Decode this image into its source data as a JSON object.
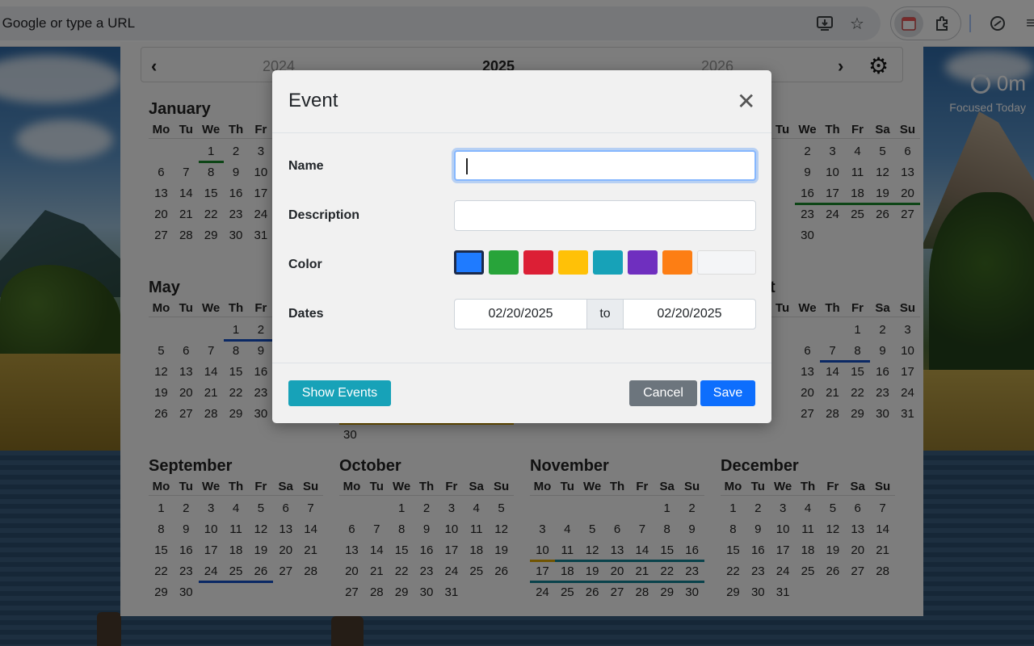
{
  "browser": {
    "omnibox_text": "ch Google or type a URL"
  },
  "focus_widget": {
    "value": "0m",
    "label": "Focused Today"
  },
  "calendar": {
    "prev_year": "2024",
    "current_year": "2025",
    "next_year": "2026",
    "weekday_headers": [
      "Mo",
      "Tu",
      "We",
      "Th",
      "Fr",
      "Sa",
      "Su"
    ],
    "months": {
      "january": {
        "title": "January",
        "weeks": [
          [
            "",
            "",
            "1",
            "2",
            "3",
            "",
            ""
          ],
          [
            "6",
            "7",
            "8",
            "9",
            "10",
            "",
            ""
          ],
          [
            "13",
            "14",
            "15",
            "16",
            "17",
            "",
            ""
          ],
          [
            "20",
            "21",
            "22",
            "23",
            "24",
            "",
            ""
          ],
          [
            "27",
            "28",
            "29",
            "30",
            "31",
            "",
            ""
          ]
        ]
      },
      "may": {
        "title": "May",
        "weeks": [
          [
            "",
            "",
            "",
            "1",
            "2",
            "",
            ""
          ],
          [
            "5",
            "6",
            "7",
            "8",
            "9",
            "",
            ""
          ],
          [
            "12",
            "13",
            "14",
            "15",
            "16",
            "",
            ""
          ],
          [
            "19",
            "20",
            "21",
            "22",
            "23",
            "",
            ""
          ],
          [
            "26",
            "27",
            "28",
            "29",
            "30",
            "",
            ""
          ]
        ]
      },
      "april_partial": {
        "weeks": [
          [
            "",
            "2",
            "3",
            "4",
            "5",
            "6"
          ],
          [
            "",
            "9",
            "10",
            "11",
            "12",
            "13"
          ],
          [
            "",
            "16",
            "17",
            "18",
            "19",
            "20"
          ],
          [
            "",
            "23",
            "24",
            "25",
            "26",
            "27"
          ],
          [
            "",
            "30",
            "",
            "",
            "",
            ""
          ]
        ]
      },
      "august_partial": {
        "title_fragment": "t",
        "weeks": [
          [
            "",
            "",
            "",
            "1",
            "2",
            "3"
          ],
          [
            "",
            "6",
            "7",
            "8",
            "9",
            "10"
          ],
          [
            "",
            "13",
            "14",
            "15",
            "16",
            "17"
          ],
          [
            "",
            "20",
            "21",
            "22",
            "23",
            "24"
          ],
          [
            "",
            "27",
            "28",
            "29",
            "30",
            "31"
          ]
        ]
      },
      "june_tail": {
        "trailing_day": "30"
      },
      "september": {
        "title": "September",
        "weeks": [
          [
            "1",
            "2",
            "3",
            "4",
            "5",
            "6",
            "7"
          ],
          [
            "8",
            "9",
            "10",
            "11",
            "12",
            "13",
            "14"
          ],
          [
            "15",
            "16",
            "17",
            "18",
            "19",
            "20",
            "21"
          ],
          [
            "22",
            "23",
            "24",
            "25",
            "26",
            "27",
            "28"
          ],
          [
            "29",
            "30",
            "",
            "",
            "",
            "",
            ""
          ]
        ]
      },
      "october": {
        "title": "October",
        "weeks": [
          [
            "",
            "",
            "1",
            "2",
            "3",
            "4",
            "5"
          ],
          [
            "6",
            "7",
            "8",
            "9",
            "10",
            "11",
            "12"
          ],
          [
            "13",
            "14",
            "15",
            "16",
            "17",
            "18",
            "19"
          ],
          [
            "20",
            "21",
            "22",
            "23",
            "24",
            "25",
            "26"
          ],
          [
            "27",
            "28",
            "29",
            "30",
            "31",
            "",
            ""
          ]
        ]
      },
      "november": {
        "title": "November",
        "weeks": [
          [
            "",
            "",
            "",
            "",
            "",
            "1",
            "2"
          ],
          [
            "3",
            "4",
            "5",
            "6",
            "7",
            "8",
            "9"
          ],
          [
            "10",
            "11",
            "12",
            "13",
            "14",
            "15",
            "16"
          ],
          [
            "17",
            "18",
            "19",
            "20",
            "21",
            "22",
            "23"
          ],
          [
            "24",
            "25",
            "26",
            "27",
            "28",
            "29",
            "30"
          ]
        ]
      },
      "december": {
        "title": "December",
        "weeks": [
          [
            "1",
            "2",
            "3",
            "4",
            "5",
            "6",
            "7"
          ],
          [
            "8",
            "9",
            "10",
            "11",
            "12",
            "13",
            "14"
          ],
          [
            "15",
            "16",
            "17",
            "18",
            "19",
            "20",
            "21"
          ],
          [
            "22",
            "23",
            "24",
            "25",
            "26",
            "27",
            "28"
          ],
          [
            "29",
            "30",
            "31",
            "",
            "",
            "",
            ""
          ]
        ]
      }
    },
    "event_colors": {
      "green": "#1a8a2c",
      "blue": "#1550c8",
      "yellow": "#e0a800",
      "teal": "#138496"
    }
  },
  "modal": {
    "title": "Event",
    "close_glyph": "✕",
    "name_label": "Name",
    "name_value": "",
    "description_label": "Description",
    "description_value": "",
    "color_label": "Color",
    "colors": [
      "#1f7bff",
      "#28a43a",
      "#dc1f35",
      "#ffc107",
      "#17a2b8",
      "#6f2fbf",
      "#fd7e14",
      "#f4f5f7"
    ],
    "selected_color": "#1f7bff",
    "dates_label": "Dates",
    "date_from": "02/20/2025",
    "date_to_label": "to",
    "date_to": "02/20/2025",
    "show_events_label": "Show Events",
    "cancel_label": "Cancel",
    "save_label": "Save"
  }
}
